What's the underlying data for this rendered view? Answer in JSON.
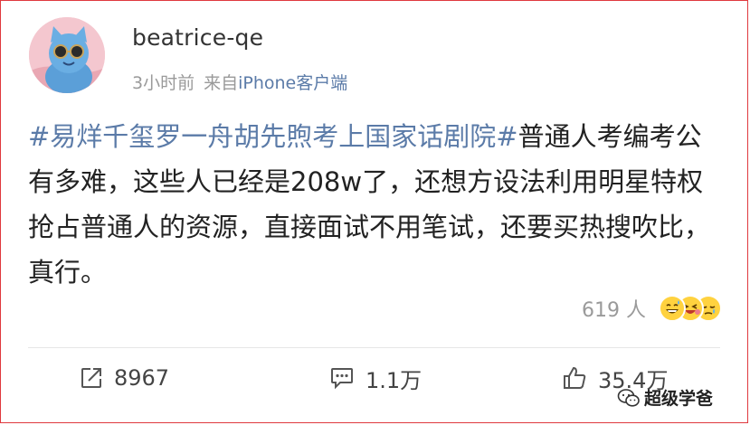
{
  "post": {
    "author": {
      "username": "beatrice-qe"
    },
    "meta": {
      "time": "3小时前",
      "source_prefix": "来自",
      "device": "iPhone客户端"
    },
    "content": {
      "topic": "#易烊千玺罗一舟胡先煦考上国家话剧院#",
      "text": "普通人考编考公有多难，这些人已经是208w了，还想方设法利用明星特权抢占普通人的资源，直接面试不用笔试，还要买热搜吹比，真行。"
    },
    "likers": {
      "count": "619 人",
      "emoji_icons": [
        "grinning-sweat-icon",
        "rolling-laugh-icon",
        "pensive-icon"
      ]
    },
    "actions": {
      "repost": {
        "icon": "repost-icon",
        "count": "8967"
      },
      "comment": {
        "icon": "comment-icon",
        "count": "1.1万"
      },
      "like": {
        "icon": "thumbs-up-icon",
        "count": "35.4万"
      }
    }
  },
  "watermark": {
    "text": "超级学爸"
  },
  "colors": {
    "link": "#5b7ba8",
    "border": "#e0393e",
    "meta": "#9a9a9a"
  }
}
